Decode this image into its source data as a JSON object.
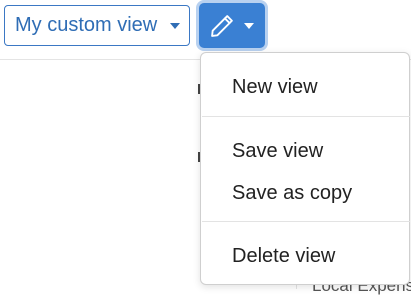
{
  "toolbar": {
    "view_select_label": "My custom view"
  },
  "background": {
    "peek_text": "Local Expens"
  },
  "menu": {
    "items": [
      {
        "label": "New view"
      },
      {
        "label": "Save view"
      },
      {
        "label": "Save as copy"
      },
      {
        "label": "Delete view"
      }
    ]
  },
  "colors": {
    "accent": "#3a80d3",
    "accent_border": "#3b78c4",
    "text": "#222222"
  },
  "icons": {
    "edit": "pencil-icon",
    "caret": "chevron-down-icon"
  }
}
